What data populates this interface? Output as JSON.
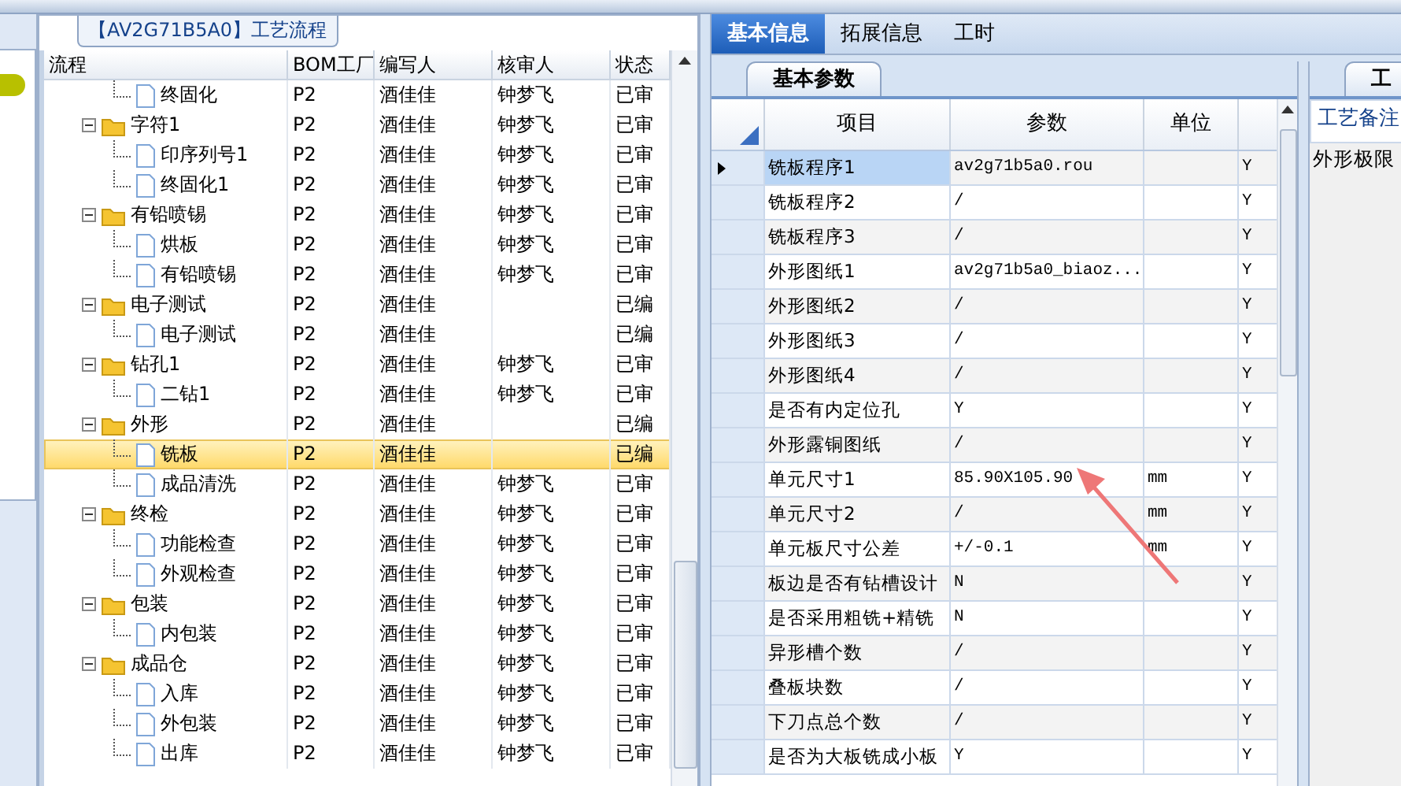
{
  "process_panel": {
    "title": "【AV2G71B5A0】工艺流程",
    "columns": [
      {
        "label": "流程"
      },
      {
        "label": "BOM工厂"
      },
      {
        "label": "编写人"
      },
      {
        "label": "核审人"
      },
      {
        "label": "状态"
      }
    ],
    "rows": [
      {
        "kind": "file",
        "name": "终固化",
        "factory": "P2",
        "author": "酒佳佳",
        "reviewer": "钟梦飞",
        "status": "已审",
        "selected": false
      },
      {
        "kind": "folder",
        "name": "字符1",
        "factory": "P2",
        "author": "酒佳佳",
        "reviewer": "钟梦飞",
        "status": "已审",
        "selected": false,
        "expanded": true,
        "children": [
          {
            "kind": "file",
            "name": "印序列号1",
            "factory": "P2",
            "author": "酒佳佳",
            "reviewer": "钟梦飞",
            "status": "已审",
            "selected": false
          },
          {
            "kind": "file",
            "name": "终固化1",
            "factory": "P2",
            "author": "酒佳佳",
            "reviewer": "钟梦飞",
            "status": "已审",
            "selected": false
          }
        ]
      },
      {
        "kind": "folder",
        "name": "有铅喷锡",
        "factory": "P2",
        "author": "酒佳佳",
        "reviewer": "钟梦飞",
        "status": "已审",
        "selected": false,
        "expanded": true,
        "children": [
          {
            "kind": "file",
            "name": "烘板",
            "factory": "P2",
            "author": "酒佳佳",
            "reviewer": "钟梦飞",
            "status": "已审",
            "selected": false
          },
          {
            "kind": "file",
            "name": "有铅喷锡",
            "factory": "P2",
            "author": "酒佳佳",
            "reviewer": "钟梦飞",
            "status": "已审",
            "selected": false
          }
        ]
      },
      {
        "kind": "folder",
        "name": "电子测试",
        "factory": "P2",
        "author": "酒佳佳",
        "status": "已编",
        "selected": false,
        "expanded": true,
        "children": [
          {
            "kind": "file",
            "name": "电子测试",
            "factory": "P2",
            "author": "酒佳佳",
            "status": "已编",
            "selected": false
          }
        ]
      },
      {
        "kind": "folder",
        "name": "钻孔1",
        "factory": "P2",
        "author": "酒佳佳",
        "reviewer": "钟梦飞",
        "status": "已审",
        "selected": false,
        "expanded": true,
        "children": [
          {
            "kind": "file",
            "name": "二钻1",
            "factory": "P2",
            "author": "酒佳佳",
            "reviewer": "钟梦飞",
            "status": "已审",
            "selected": false
          }
        ]
      },
      {
        "kind": "folder",
        "name": "外形",
        "factory": "P2",
        "author": "酒佳佳",
        "status": "已编",
        "selected": false,
        "expanded": true,
        "children": [
          {
            "kind": "file",
            "name": "铣板",
            "factory": "P2",
            "author": "酒佳佳",
            "status": "已编",
            "selected": true
          },
          {
            "kind": "file",
            "name": "成品清洗",
            "factory": "P2",
            "author": "酒佳佳",
            "reviewer": "钟梦飞",
            "status": "已审",
            "selected": false
          }
        ]
      },
      {
        "kind": "folder",
        "name": "终检",
        "factory": "P2",
        "author": "酒佳佳",
        "reviewer": "钟梦飞",
        "status": "已审",
        "selected": false,
        "expanded": true,
        "children": [
          {
            "kind": "file",
            "name": "功能检查",
            "factory": "P2",
            "author": "酒佳佳",
            "reviewer": "钟梦飞",
            "status": "已审",
            "selected": false
          },
          {
            "kind": "file",
            "name": "外观检查",
            "factory": "P2",
            "author": "酒佳佳",
            "reviewer": "钟梦飞",
            "status": "已审",
            "selected": false
          }
        ]
      },
      {
        "kind": "folder",
        "name": "包装",
        "factory": "P2",
        "author": "酒佳佳",
        "reviewer": "钟梦飞",
        "status": "已审",
        "selected": false,
        "expanded": true,
        "children": [
          {
            "kind": "file",
            "name": "内包装",
            "factory": "P2",
            "author": "酒佳佳",
            "reviewer": "钟梦飞",
            "status": "已审",
            "selected": false
          }
        ]
      },
      {
        "kind": "folder",
        "name": "成品仓",
        "factory": "P2",
        "author": "酒佳佳",
        "reviewer": "钟梦飞",
        "status": "已审",
        "selected": false,
        "expanded": true,
        "children": [
          {
            "kind": "file",
            "name": "入库",
            "factory": "P2",
            "author": "酒佳佳",
            "reviewer": "钟梦飞",
            "status": "已审",
            "selected": false
          },
          {
            "kind": "file",
            "name": "外包装",
            "factory": "P2",
            "author": "酒佳佳",
            "reviewer": "钟梦飞",
            "status": "已审",
            "selected": false
          },
          {
            "kind": "file",
            "name": "出库",
            "factory": "P2",
            "author": "酒佳佳",
            "reviewer": "钟梦飞",
            "status": "已审",
            "selected": false
          }
        ]
      }
    ]
  },
  "tabs": [
    {
      "label": "基本信息",
      "selected": true
    },
    {
      "label": "拓展信息",
      "selected": false
    },
    {
      "label": "工时",
      "selected": false
    }
  ],
  "params": {
    "tab": {
      "label": "基本参数"
    },
    "columns": [
      {
        "label": "项目"
      },
      {
        "label": "参数"
      },
      {
        "label": "单位"
      }
    ],
    "rows": [
      {
        "item": "铣板程序1",
        "value": "av2g71b5a0.rou",
        "column_4": "Y",
        "selected": true
      },
      {
        "item": "铣板程序2",
        "value": "/",
        "column_4": "Y",
        "selected": false
      },
      {
        "item": "铣板程序3",
        "value": "/",
        "column_4": "Y",
        "selected": false
      },
      {
        "item": "外形图纸1",
        "value": "av2g71b5a0_biaoz...",
        "column_4": "Y",
        "selected": false
      },
      {
        "item": "外形图纸2",
        "value": "/",
        "column_4": "Y",
        "selected": false
      },
      {
        "item": "外形图纸3",
        "value": "/",
        "column_4": "Y",
        "selected": false
      },
      {
        "item": "外形图纸4",
        "value": "/",
        "column_4": "Y",
        "selected": false
      },
      {
        "item": "是否有内定位孔",
        "value": "Y",
        "column_4": "Y",
        "selected": false
      },
      {
        "item": "外形露铜图纸",
        "value": "/",
        "column_4": "Y",
        "selected": false
      },
      {
        "item": "单元尺寸1",
        "value": "85.90X105.90",
        "unit": "mm",
        "column_4": "Y",
        "selected": false
      },
      {
        "item": "单元尺寸2",
        "value": "/",
        "unit": "mm",
        "column_4": "Y",
        "selected": false
      },
      {
        "item": "单元板尺寸公差",
        "value": "+/-0.1",
        "unit": "mm",
        "column_4": "Y",
        "selected": false
      },
      {
        "item": "板边是否有钻槽设计",
        "value": "N",
        "column_4": "Y",
        "selected": false
      },
      {
        "item": "是否采用粗铣+精铣",
        "value": "N",
        "column_4": "Y",
        "selected": false
      },
      {
        "item": "异形槽个数",
        "value": "/",
        "column_4": "Y",
        "selected": false
      },
      {
        "item": "叠板块数",
        "value": "/",
        "column_4": "Y",
        "selected": false
      },
      {
        "item": "下刀点总个数",
        "value": "/",
        "column_4": "Y",
        "selected": false
      },
      {
        "item": "是否为大板铣成小板",
        "value": "Y",
        "column_4": "Y",
        "selected": false
      }
    ]
  },
  "notes": {
    "tab": {
      "label": "工"
    },
    "columns": [
      {
        "label": "工艺备注"
      }
    ],
    "text": "外形极限"
  }
}
